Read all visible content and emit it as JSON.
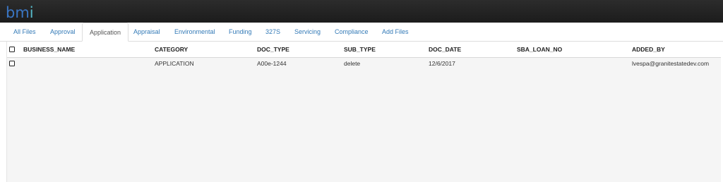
{
  "header": {
    "logo_main": "bm",
    "logo_accent": "i"
  },
  "tabs": [
    {
      "label": "All Files"
    },
    {
      "label": "Approval"
    },
    {
      "label": "Application"
    },
    {
      "label": "Appraisal"
    },
    {
      "label": "Environmental"
    },
    {
      "label": "Funding"
    },
    {
      "label": "327S"
    },
    {
      "label": "Servicing"
    },
    {
      "label": "Compliance"
    },
    {
      "label": "Add Files"
    }
  ],
  "active_tab": "Application",
  "table": {
    "columns": [
      "BUSINESS_NAME",
      "CATEGORY",
      "DOC_TYPE",
      "SUB_TYPE",
      "DOC_DATE",
      "SBA_LOAN_NO",
      "ADDED_BY"
    ],
    "rows": [
      {
        "business_name": "",
        "category": "APPLICATION",
        "doc_type": "A00e-1244",
        "sub_type": "delete",
        "doc_date": "12/6/2017",
        "sba_loan_no": "",
        "added_by": "lvespa@granitestatedev.com"
      }
    ]
  },
  "colors": {
    "topbar": "#222222",
    "link": "#337ab7",
    "logo_blue": "#3a76c4",
    "logo_teal": "#56b9c9"
  }
}
